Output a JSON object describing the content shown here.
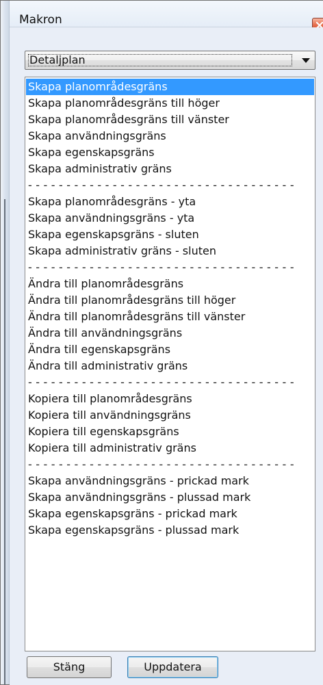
{
  "window": {
    "title": "Makron"
  },
  "dropdown": {
    "value": "Detaljplan"
  },
  "list": {
    "items": [
      {
        "label": "Skapa planområdesgräns",
        "kind": "item",
        "selected": true
      },
      {
        "label": "Skapa planområdesgräns till höger",
        "kind": "item"
      },
      {
        "label": "Skapa planområdesgräns till vänster",
        "kind": "item"
      },
      {
        "label": "Skapa användningsgräns",
        "kind": "item"
      },
      {
        "label": "Skapa egenskapsgräns",
        "kind": "item"
      },
      {
        "label": "Skapa administrativ gräns",
        "kind": "item"
      },
      {
        "label": "- - - - - - - - - - - - - - - - - - - - - - - - - - - - - - - - - - -",
        "kind": "separator"
      },
      {
        "label": "Skapa planområdesgräns - yta",
        "kind": "item"
      },
      {
        "label": "Skapa användningsgräns - yta",
        "kind": "item"
      },
      {
        "label": "Skapa egenskapsgräns - sluten",
        "kind": "item"
      },
      {
        "label": "Skapa administrativ gräns - sluten",
        "kind": "item"
      },
      {
        "label": "- - - - - - - - - - - - - - - - - - - - - - - - - - - - - - - - - - -",
        "kind": "separator"
      },
      {
        "label": "Ändra till planområdesgräns",
        "kind": "item"
      },
      {
        "label": "Ändra till planområdesgräns till höger",
        "kind": "item"
      },
      {
        "label": "Ändra till planområdesgräns till vänster",
        "kind": "item"
      },
      {
        "label": "Ändra till användningsgräns",
        "kind": "item"
      },
      {
        "label": "Ändra till egenskapsgräns",
        "kind": "item"
      },
      {
        "label": "Ändra till administrativ gräns",
        "kind": "item"
      },
      {
        "label": "- - - - - - - - - - - - - - - - - - - - - - - - - - - - - - - - - - -",
        "kind": "separator"
      },
      {
        "label": "Kopiera till planområdesgräns",
        "kind": "item"
      },
      {
        "label": "Kopiera till användningsgräns",
        "kind": "item"
      },
      {
        "label": "Kopiera till egenskapsgräns",
        "kind": "item"
      },
      {
        "label": "Kopiera till administrativ gräns",
        "kind": "item"
      },
      {
        "label": "- - - - - - - - - - - - - - - - - - - - - - - - - - - - - - - - - - -",
        "kind": "separator"
      },
      {
        "label": "Skapa användningsgräns - prickad mark",
        "kind": "item"
      },
      {
        "label": "Skapa användningsgräns - plussad mark",
        "kind": "item"
      },
      {
        "label": "Skapa egenskapsgräns - prickad mark",
        "kind": "item"
      },
      {
        "label": "Skapa egenskapsgräns - plussad mark",
        "kind": "item"
      }
    ]
  },
  "buttons": {
    "close_label": "Stäng",
    "update_label": "Uppdatera"
  },
  "colors": {
    "selection": "#3399ff",
    "close_button": "#e7704f",
    "window_background": "#e9eef7"
  }
}
